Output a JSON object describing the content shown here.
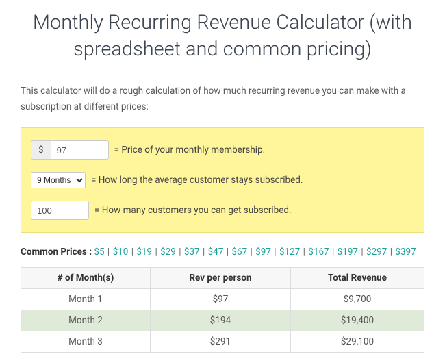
{
  "title": "Monthly Recurring Revenue Calculator (with spreadsheet and common pricing)",
  "intro": "This calculator will do a rough calculation of how much recurring revenue you can make with a subscription at different prices:",
  "inputs": {
    "currency_symbol": "$",
    "price_value": "97",
    "price_label": "= Price of your monthly membership.",
    "duration_value": "9 Months",
    "duration_label": "= How long the average customer stays subscribed.",
    "customers_value": "100",
    "customers_label": "= How many customers you can get subscribed."
  },
  "common_prices_label": "Common Prices :",
  "common_prices": [
    "$5",
    "$10",
    "$19",
    "$29",
    "$37",
    "$47",
    "$67",
    "$97",
    "$127",
    "$167",
    "$197",
    "$297",
    "$397"
  ],
  "table": {
    "headers": [
      "# of Month(s)",
      "Rev per person",
      "Total Revenue"
    ],
    "rows": [
      [
        "Month 1",
        "$97",
        "$9,700"
      ],
      [
        "Month 2",
        "$194",
        "$19,400"
      ],
      [
        "Month 3",
        "$291",
        "$29,100"
      ]
    ]
  }
}
